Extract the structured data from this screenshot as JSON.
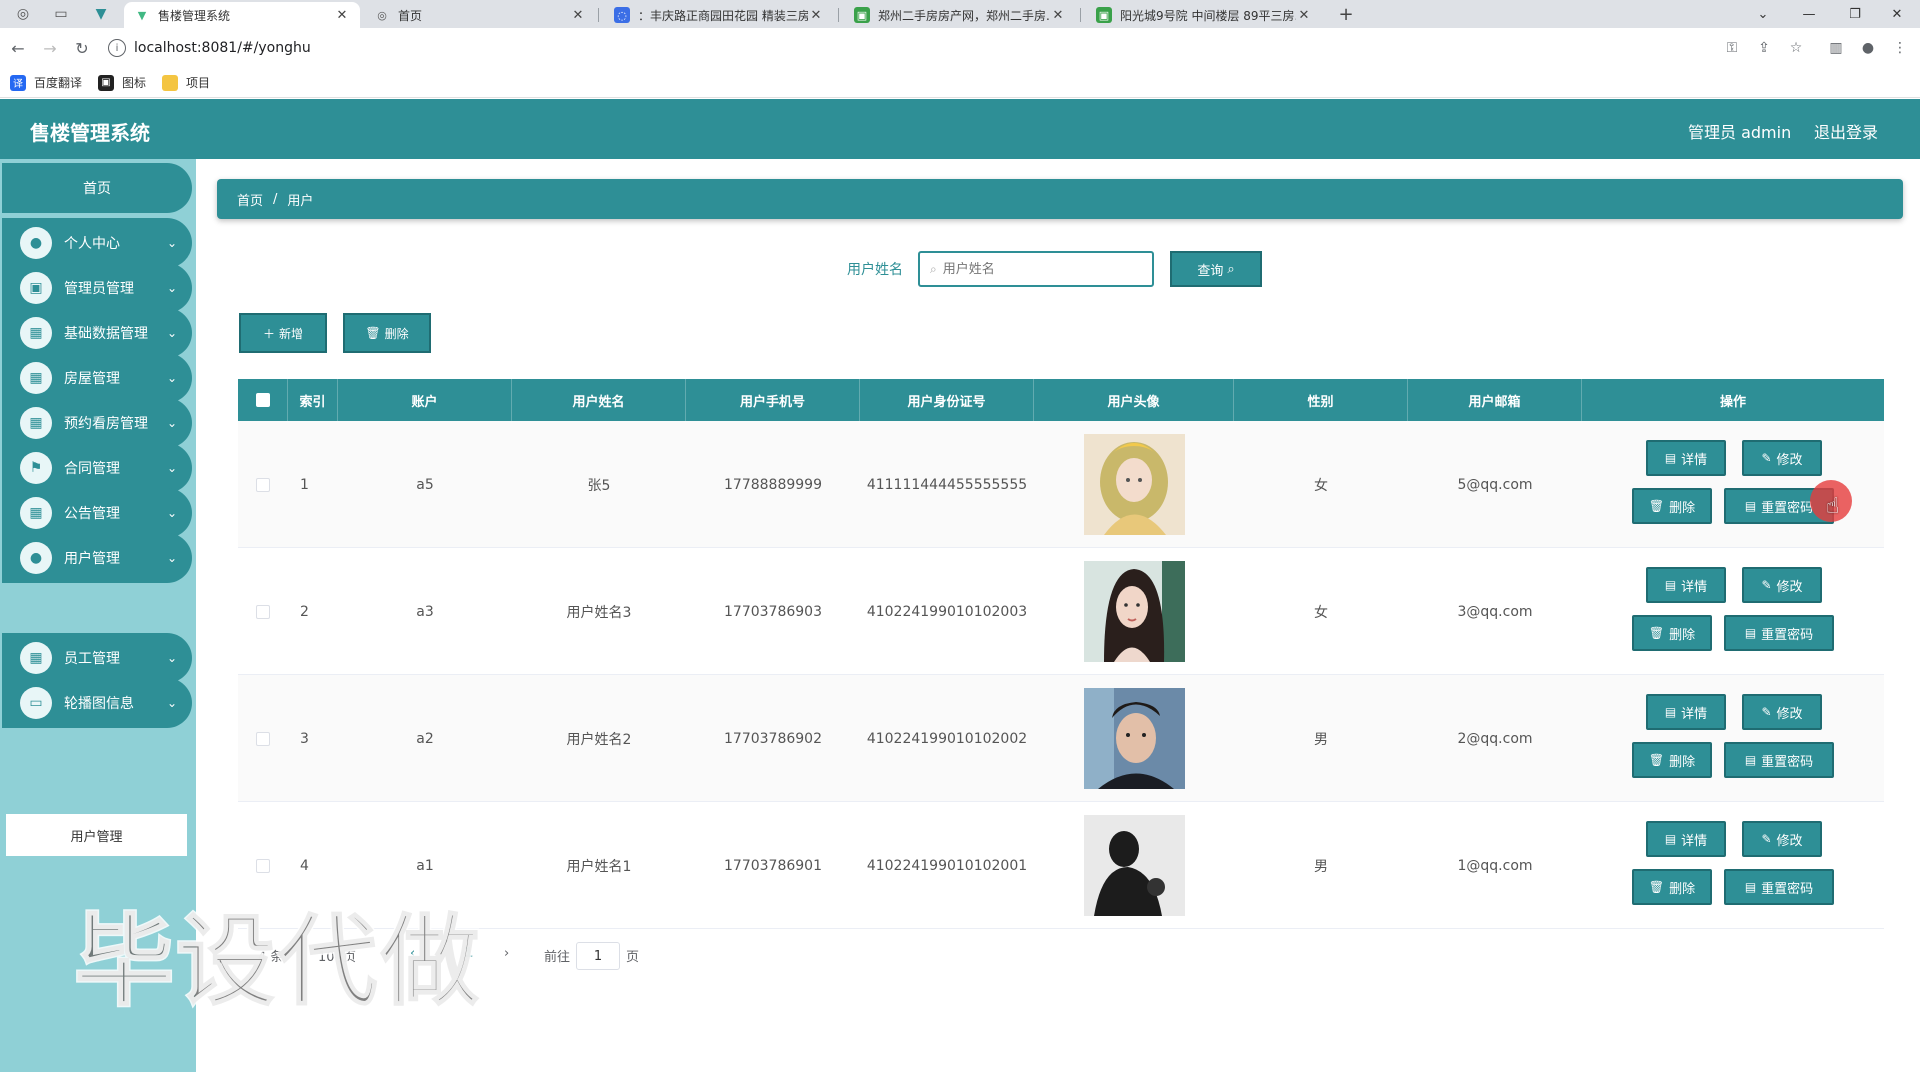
{
  "browser": {
    "tabs": [
      {
        "title": "售楼管理系统",
        "icon": "vue-icon",
        "active": true
      },
      {
        "title": "首页",
        "icon": "globe-icon",
        "active": false
      },
      {
        "title": "：丰庆路正商园田花园 精装三房...",
        "icon": "page-icon",
        "active": false
      },
      {
        "title": "郑州二手房房产网，郑州二手房...",
        "icon": "site-icon",
        "active": false
      },
      {
        "title": "阳光城9号院 中间楼层 89平三房...",
        "icon": "site-icon",
        "active": false
      }
    ],
    "url": "localhost:8081/#/yonghu",
    "bookmarks": [
      {
        "label": "百度翻译",
        "color": "#2468f2"
      },
      {
        "label": "图标",
        "color": "#222222"
      },
      {
        "label": "项目",
        "color": "#f4c542"
      }
    ]
  },
  "header": {
    "title": "售楼管理系统",
    "user": "管理员 admin",
    "logout": "退出登录"
  },
  "sidebar": {
    "home": "首页",
    "items": [
      {
        "label": "个人中心",
        "icon": "user-icon"
      },
      {
        "label": "管理员管理",
        "icon": "admin-icon"
      },
      {
        "label": "基础数据管理",
        "icon": "grid-icon"
      },
      {
        "label": "房屋管理",
        "icon": "grid-icon"
      },
      {
        "label": "预约看房管理",
        "icon": "grid-icon"
      },
      {
        "label": "合同管理",
        "icon": "flag-icon"
      },
      {
        "label": "公告管理",
        "icon": "grid-icon"
      },
      {
        "label": "用户管理",
        "icon": "user-icon"
      },
      {
        "label": "员工管理",
        "icon": "grid-icon"
      },
      {
        "label": "轮播图信息",
        "icon": "monitor-icon"
      }
    ],
    "submenu": "用户管理"
  },
  "breadcrumb": {
    "home": "首页",
    "sep": "/",
    "current": "用户"
  },
  "search": {
    "label": "用户姓名",
    "placeholder": "用户姓名",
    "button": "查询"
  },
  "actions": {
    "add": "新增",
    "delete": "删除"
  },
  "table": {
    "headers": [
      "索引",
      "账户",
      "用户姓名",
      "用户手机号",
      "用户身份证号",
      "用户头像",
      "性别",
      "用户邮箱",
      "操作"
    ],
    "rows": [
      {
        "index": "1",
        "account": "a5",
        "name": "张5",
        "phone": "17788889999",
        "id_card": "411111444455555555",
        "avatar": "girl-illustration",
        "gender": "女",
        "email": "5@qq.com"
      },
      {
        "index": "2",
        "account": "a3",
        "name": "用户姓名3",
        "phone": "17703786903",
        "id_card": "410224199010102003",
        "avatar": "woman-portrait",
        "gender": "女",
        "email": "3@qq.com"
      },
      {
        "index": "3",
        "account": "a2",
        "name": "用户姓名2",
        "phone": "17703786902",
        "id_card": "410224199010102002",
        "avatar": "man-portrait",
        "gender": "男",
        "email": "2@qq.com"
      },
      {
        "index": "4",
        "account": "a1",
        "name": "用户姓名1",
        "phone": "17703786901",
        "id_card": "410224199010102001",
        "avatar": "silhouette",
        "gender": "男",
        "email": "1@qq.com"
      }
    ],
    "row_buttons": {
      "detail": "详情",
      "edit": "修改",
      "delete": "删除",
      "reset": "重置密码"
    }
  },
  "pagination": {
    "total": "4 条",
    "page_size": "10 /页",
    "current": "1",
    "goto_label": "前往",
    "goto_value": "1",
    "page_unit": "页"
  },
  "watermark": "毕设代做",
  "colors": {
    "primary": "#2e8f96",
    "sidebar_bg": "#8fd0d6"
  }
}
